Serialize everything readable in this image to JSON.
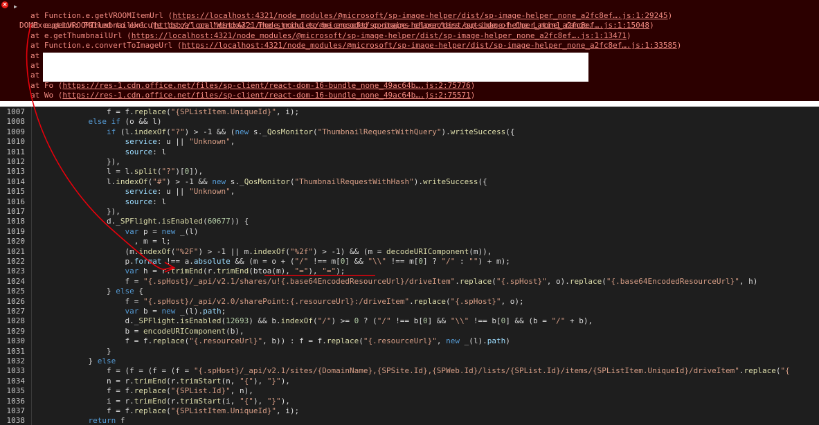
{
  "console": {
    "error_message": "DOMException: Failed to execute 'btoa' on 'Window': The string to be encoded contains characters outside of the Latin1 range.",
    "stack": [
      {
        "text": "at Function.e.getVROOMItemUrl (",
        "link": "https://localhost:4321/node_modules/@microsoft/sp-image-helper/dist/sp-image-helper_none_a2fc8ef….js:1:29245",
        "close": ")"
      },
      {
        "text": "at e.getVROOMThumbnailUrl (",
        "link": "https://localhost:4321/node_modules/@microsoft/sp-image-helper/dist/sp-image-helper_none_a2fc8ef….js:1:15048",
        "close": ")"
      },
      {
        "text": "at e.getThumbnailUrl (",
        "link": "https://localhost:4321/node_modules/@microsoft/sp-image-helper/dist/sp-image-helper_none_a2fc8ef….js:1:13471",
        "close": ")"
      },
      {
        "text": "at Function.e.convertToImageUrl (",
        "link": "https://localhost:4321/node_modules/@microsoft/sp-image-helper/dist/sp-image-helper_none_a2fc8ef….js:1:33585",
        "close": ")"
      },
      {
        "text": "at",
        "link": "",
        "close": ""
      },
      {
        "text": "at",
        "link": "",
        "close": ""
      },
      {
        "text": "at",
        "link": "",
        "close": ""
      },
      {
        "text": "at Fo (",
        "link": "https://res-1.cdn.office.net/files/sp-client/react-dom-16-bundle_none_49ac64b….js:2:75776",
        "close": ")"
      },
      {
        "text": "at Wo (",
        "link": "https://res-1.cdn.office.net/files/sp-client/react-dom-16-bundle_none_49ac64b….js:2:75571",
        "close": ")"
      }
    ]
  },
  "colors": {
    "console_bg": "#2c0000",
    "error_text": "#f28b82",
    "editor_bg": "#1e1e1e",
    "annotation": "#e8000b"
  },
  "code_lines": [
    {
      "num": "1007",
      "indent": 16,
      "tokens": [
        [
          "",
          "f = f."
        ],
        [
          "f",
          "replace"
        ],
        [
          "",
          "("
        ],
        [
          "s",
          "\"{SPListItem.UniqueId}\""
        ],
        [
          "",
          ", i);"
        ]
      ]
    },
    {
      "num": "1008",
      "indent": 12,
      "tokens": [
        [
          "k",
          "else if"
        ],
        [
          "",
          " (o && l)"
        ]
      ]
    },
    {
      "num": "1009",
      "indent": 16,
      "tokens": [
        [
          "k",
          "if"
        ],
        [
          "",
          " (l."
        ],
        [
          "f",
          "indexOf"
        ],
        [
          "",
          "("
        ],
        [
          "s",
          "\"?\""
        ],
        [
          "",
          ") > -1 && ("
        ],
        [
          "k",
          "new"
        ],
        [
          "",
          " s._"
        ],
        [
          "f",
          "QosMonitor"
        ],
        [
          "",
          "("
        ],
        [
          "s",
          "\"ThumbnailRequestWithQuery\""
        ],
        [
          "",
          ")."
        ],
        [
          "f",
          "writeSuccess"
        ],
        [
          "",
          "({"
        ]
      ]
    },
    {
      "num": "1010",
      "indent": 20,
      "tokens": [
        [
          "p",
          "service"
        ],
        [
          "",
          ": u || "
        ],
        [
          "s",
          "\"Unknown\""
        ],
        [
          "",
          ","
        ]
      ]
    },
    {
      "num": "1011",
      "indent": 20,
      "tokens": [
        [
          "p",
          "source"
        ],
        [
          "",
          ": l"
        ]
      ]
    },
    {
      "num": "1012",
      "indent": 16,
      "tokens": [
        [
          "",
          "}),"
        ]
      ]
    },
    {
      "num": "1013",
      "indent": 16,
      "tokens": [
        [
          "",
          "l = l."
        ],
        [
          "f",
          "split"
        ],
        [
          "",
          "("
        ],
        [
          "s",
          "\"?\""
        ],
        [
          "",
          ")["
        ],
        [
          "n",
          "0"
        ],
        [
          "",
          "]),"
        ]
      ]
    },
    {
      "num": "1014",
      "indent": 16,
      "tokens": [
        [
          "",
          "l."
        ],
        [
          "f",
          "indexOf"
        ],
        [
          "",
          "("
        ],
        [
          "s",
          "\"#\""
        ],
        [
          "",
          ") > -1 && "
        ],
        [
          "k",
          "new"
        ],
        [
          "",
          " s._"
        ],
        [
          "f",
          "QosMonitor"
        ],
        [
          "",
          "("
        ],
        [
          "s",
          "\"ThumbnailRequestWithHash\""
        ],
        [
          "",
          ")."
        ],
        [
          "f",
          "writeSuccess"
        ],
        [
          "",
          "({"
        ]
      ]
    },
    {
      "num": "1015",
      "indent": 20,
      "tokens": [
        [
          "p",
          "service"
        ],
        [
          "",
          ": u || "
        ],
        [
          "s",
          "\"Unknown\""
        ],
        [
          "",
          ","
        ]
      ]
    },
    {
      "num": "1016",
      "indent": 20,
      "tokens": [
        [
          "p",
          "source"
        ],
        [
          "",
          ": l"
        ]
      ]
    },
    {
      "num": "1017",
      "indent": 16,
      "tokens": [
        [
          "",
          "}),"
        ]
      ]
    },
    {
      "num": "1018",
      "indent": 16,
      "tokens": [
        [
          "",
          "d._"
        ],
        [
          "f",
          "SPFlight"
        ],
        [
          "",
          "."
        ],
        [
          "f",
          "isEnabled"
        ],
        [
          "",
          "("
        ],
        [
          "n",
          "60677"
        ],
        [
          "",
          ")) {"
        ]
      ]
    },
    {
      "num": "1019",
      "indent": 20,
      "tokens": [
        [
          "k",
          "var"
        ],
        [
          "",
          " p = "
        ],
        [
          "k",
          "new"
        ],
        [
          "",
          " _(l)"
        ]
      ]
    },
    {
      "num": "1020",
      "indent": 22,
      "tokens": [
        [
          "",
          ", m = l;"
        ]
      ]
    },
    {
      "num": "1021",
      "indent": 20,
      "tokens": [
        [
          "",
          "(m."
        ],
        [
          "f",
          "indexOf"
        ],
        [
          "",
          "("
        ],
        [
          "s",
          "\"%2F\""
        ],
        [
          "",
          ") > -1 || m."
        ],
        [
          "f",
          "indexOf"
        ],
        [
          "",
          "("
        ],
        [
          "s",
          "\"%2f\""
        ],
        [
          "",
          ") > -1) && (m = "
        ],
        [
          "f",
          "decodeURIComponent"
        ],
        [
          "",
          "(m)),"
        ]
      ]
    },
    {
      "num": "1022",
      "indent": 20,
      "tokens": [
        [
          "",
          "p."
        ],
        [
          "p",
          "format"
        ],
        [
          "",
          " !== a."
        ],
        [
          "p",
          "absolute"
        ],
        [
          "",
          " && (m = o + ("
        ],
        [
          "s",
          "\"/\""
        ],
        [
          "",
          " !== m["
        ],
        [
          "n",
          "0"
        ],
        [
          "",
          "] && "
        ],
        [
          "s",
          "\"\\\\\""
        ],
        [
          "",
          " !== m["
        ],
        [
          "n",
          "0"
        ],
        [
          "",
          "] ? "
        ],
        [
          "s",
          "\"/\""
        ],
        [
          "",
          " : "
        ],
        [
          "s",
          "\"\""
        ],
        [
          "",
          ") + m);"
        ]
      ]
    },
    {
      "num": "1023",
      "indent": 20,
      "tokens": [
        [
          "k",
          "var"
        ],
        [
          "",
          " h = r."
        ],
        [
          "f",
          "trimEnd"
        ],
        [
          "",
          "(r."
        ],
        [
          "f",
          "trimEnd"
        ],
        [
          "",
          "(btoa(m), "
        ],
        [
          "s",
          "\"=\""
        ],
        [
          "",
          "), "
        ],
        [
          "s",
          "\"=\""
        ],
        [
          "",
          ");"
        ]
      ]
    },
    {
      "num": "1024",
      "indent": 20,
      "tokens": [
        [
          "",
          "f = "
        ],
        [
          "s",
          "\"{.spHost}/_api/v2.1/shares/u!{.base64EncodedResourceUrl}/driveItem\""
        ],
        [
          "",
          "."
        ],
        [
          "f",
          "replace"
        ],
        [
          "",
          "("
        ],
        [
          "s",
          "\"{.spHost}\""
        ],
        [
          "",
          ", o)."
        ],
        [
          "f",
          "replace"
        ],
        [
          "",
          "("
        ],
        [
          "s",
          "\"{.base64EncodedResourceUrl}\""
        ],
        [
          "",
          ", h)"
        ]
      ]
    },
    {
      "num": "1025",
      "indent": 16,
      "tokens": [
        [
          "",
          "} "
        ],
        [
          "k",
          "else"
        ],
        [
          "",
          " {"
        ]
      ]
    },
    {
      "num": "1026",
      "indent": 20,
      "tokens": [
        [
          "",
          "f = "
        ],
        [
          "s",
          "\"{.spHost}/_api/v2.0/sharePoint:{.resourceUrl}:/driveItem\""
        ],
        [
          "",
          "."
        ],
        [
          "f",
          "replace"
        ],
        [
          "",
          "("
        ],
        [
          "s",
          "\"{.spHost}\""
        ],
        [
          "",
          ", o);"
        ]
      ]
    },
    {
      "num": "1027",
      "indent": 20,
      "tokens": [
        [
          "k",
          "var"
        ],
        [
          "",
          " b = "
        ],
        [
          "k",
          "new"
        ],
        [
          "",
          " _(l)."
        ],
        [
          "p",
          "path"
        ],
        [
          "",
          ";"
        ]
      ]
    },
    {
      "num": "1028",
      "indent": 20,
      "tokens": [
        [
          "",
          "d._"
        ],
        [
          "f",
          "SPFlight"
        ],
        [
          "",
          "."
        ],
        [
          "f",
          "isEnabled"
        ],
        [
          "",
          "("
        ],
        [
          "n",
          "12693"
        ],
        [
          "",
          ") && b."
        ],
        [
          "f",
          "indexOf"
        ],
        [
          "",
          "("
        ],
        [
          "s",
          "\"/\""
        ],
        [
          "",
          ") >= "
        ],
        [
          "n",
          "0"
        ],
        [
          "",
          " ? ("
        ],
        [
          "s",
          "\"/\""
        ],
        [
          "",
          " !== b["
        ],
        [
          "n",
          "0"
        ],
        [
          "",
          "] && "
        ],
        [
          "s",
          "\"\\\\\""
        ],
        [
          "",
          " !== b["
        ],
        [
          "n",
          "0"
        ],
        [
          "",
          "] && (b = "
        ],
        [
          "s",
          "\"/\""
        ],
        [
          "",
          " + b),"
        ]
      ]
    },
    {
      "num": "1029",
      "indent": 20,
      "tokens": [
        [
          "",
          "b = "
        ],
        [
          "f",
          "encodeURIComponent"
        ],
        [
          "",
          "(b),"
        ]
      ]
    },
    {
      "num": "1030",
      "indent": 20,
      "tokens": [
        [
          "",
          "f = f."
        ],
        [
          "f",
          "replace"
        ],
        [
          "",
          "("
        ],
        [
          "s",
          "\"{.resourceUrl}\""
        ],
        [
          "",
          ", b)) : f = f."
        ],
        [
          "f",
          "replace"
        ],
        [
          "",
          "("
        ],
        [
          "s",
          "\"{.resourceUrl}\""
        ],
        [
          "",
          ", "
        ],
        [
          "k",
          "new"
        ],
        [
          "",
          " _(l)."
        ],
        [
          "p",
          "path"
        ],
        [
          "",
          ")"
        ]
      ]
    },
    {
      "num": "1031",
      "indent": 16,
      "tokens": [
        [
          "",
          "}"
        ]
      ]
    },
    {
      "num": "1032",
      "indent": 12,
      "tokens": [
        [
          "",
          "} "
        ],
        [
          "k",
          "else"
        ]
      ]
    },
    {
      "num": "1033",
      "indent": 16,
      "tokens": [
        [
          "",
          "f = (f = (f = (f = "
        ],
        [
          "s",
          "\"{.spHost}/_api/v2.1/sites/{DomainName},{SPSite.Id},{SPWeb.Id}/lists/{SPList.Id}/items/{SPListItem.UniqueId}/driveItem\""
        ],
        [
          "",
          "."
        ],
        [
          "f",
          "replace"
        ],
        [
          "",
          "("
        ],
        [
          "s",
          "\"{"
        ]
      ]
    },
    {
      "num": "1034",
      "indent": 16,
      "tokens": [
        [
          "",
          "n = r."
        ],
        [
          "f",
          "trimEnd"
        ],
        [
          "",
          "(r."
        ],
        [
          "f",
          "trimStart"
        ],
        [
          "",
          "(n, "
        ],
        [
          "s",
          "\"{\""
        ],
        [
          "",
          "), "
        ],
        [
          "s",
          "\"}\""
        ],
        [
          "",
          "),"
        ]
      ]
    },
    {
      "num": "1035",
      "indent": 16,
      "tokens": [
        [
          "",
          "f = f."
        ],
        [
          "f",
          "replace"
        ],
        [
          "",
          "("
        ],
        [
          "s",
          "\"{SPList.Id}\""
        ],
        [
          "",
          ", n),"
        ]
      ]
    },
    {
      "num": "1036",
      "indent": 16,
      "tokens": [
        [
          "",
          "i = r."
        ],
        [
          "f",
          "trimEnd"
        ],
        [
          "",
          "(r."
        ],
        [
          "f",
          "trimStart"
        ],
        [
          "",
          "(i, "
        ],
        [
          "s",
          "\"{\""
        ],
        [
          "",
          "), "
        ],
        [
          "s",
          "\"}\""
        ],
        [
          "",
          "),"
        ]
      ]
    },
    {
      "num": "1037",
      "indent": 16,
      "tokens": [
        [
          "",
          "f = f."
        ],
        [
          "f",
          "replace"
        ],
        [
          "",
          "("
        ],
        [
          "s",
          "\"{SPListItem.UniqueId}\""
        ],
        [
          "",
          ", i);"
        ]
      ]
    },
    {
      "num": "1038",
      "indent": 12,
      "tokens": [
        [
          "k",
          "return"
        ],
        [
          "",
          " f"
        ]
      ]
    }
  ]
}
